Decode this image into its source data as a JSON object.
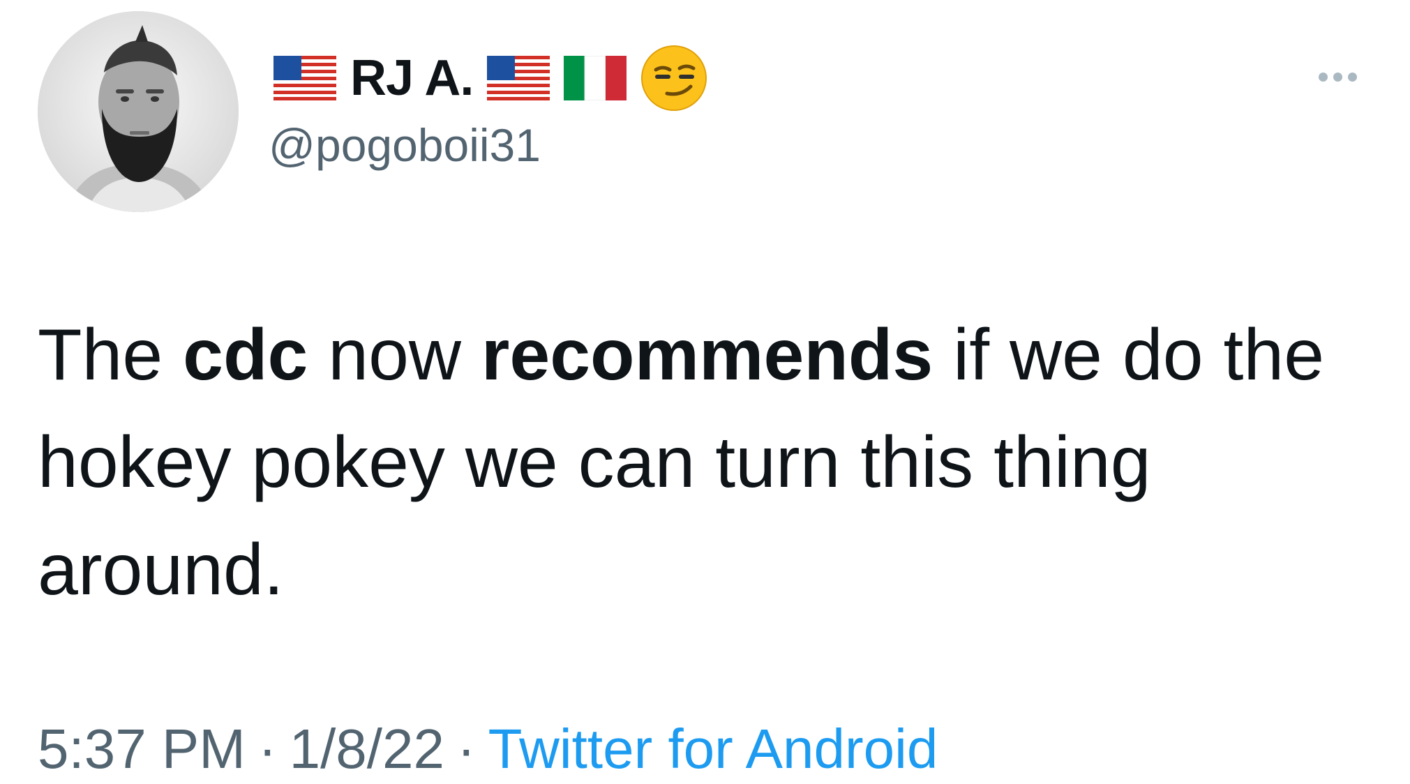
{
  "user": {
    "display_name": "RJ A.",
    "handle": "@pogoboii31",
    "avatar_icon": "profile-photo",
    "name_decorations": [
      "us-flag-icon",
      "us-flag-icon",
      "italy-flag-icon",
      "smirking-face-icon"
    ]
  },
  "tweet": {
    "segments": [
      {
        "text": "The ",
        "bold": false
      },
      {
        "text": "cdc",
        "bold": true
      },
      {
        "text": " now ",
        "bold": false
      },
      {
        "text": "recommends",
        "bold": true
      },
      {
        "text": " if we do the hokey pokey we can turn this thing around.",
        "bold": false
      }
    ]
  },
  "meta": {
    "time": "5:37 PM",
    "date": "1/8/22",
    "separator": "·",
    "source": "Twitter for Android"
  },
  "colors": {
    "text_primary": "#0f1419",
    "text_secondary": "#536471",
    "link": "#1d9bf0",
    "more_dots": "#aab8c2"
  }
}
